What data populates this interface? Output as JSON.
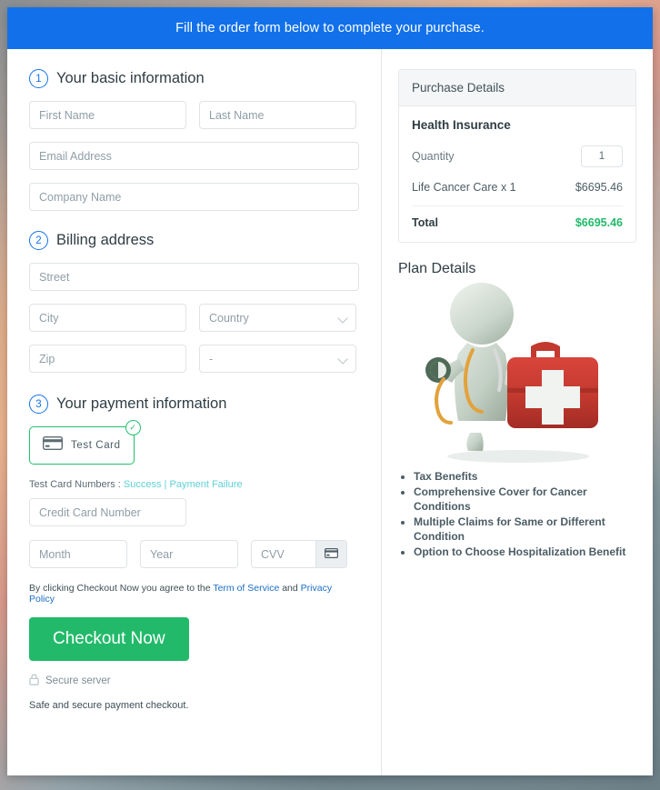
{
  "banner": {
    "text": "Fill the order form below to complete your purchase."
  },
  "sections": {
    "basic": {
      "number": "1",
      "title": "Your basic information",
      "fields": {
        "first_name": "First Name",
        "last_name": "Last Name",
        "email": "Email Address",
        "company": "Company Name"
      }
    },
    "billing": {
      "number": "2",
      "title": "Billing address",
      "fields": {
        "street": "Street",
        "city": "City",
        "country": "Country",
        "zip": "Zip",
        "state": "-"
      }
    },
    "payment": {
      "number": "3",
      "title": "Your payment information",
      "card_option_label": "Test  Card",
      "card_option_icon": "credit-card-icon",
      "selected_badge": "✓",
      "test_numbers_prefix": "Test Card Numbers : ",
      "test_success_link": "Success",
      "test_separator": " | ",
      "test_failure_link": "Payment Failure",
      "fields": {
        "credit_card": "Credit Card Number",
        "month": "Month",
        "year": "Year",
        "cvv": "CVV"
      },
      "terms_prefix": "By clicking Checkout Now you agree to the ",
      "terms_link": "Term of Service",
      "terms_and": " and ",
      "privacy_link": "Privacy Policy",
      "checkout_label": "Checkout Now",
      "secure_server": "Secure server",
      "safe_note": "Safe and secure payment checkout."
    }
  },
  "purchase": {
    "header": "Purchase Details",
    "product": "Health Insurance",
    "quantity_label": "Quantity",
    "quantity_value": "1",
    "line_item": "Life Cancer Care x 1",
    "line_amount": "$6695.46",
    "total_label": "Total",
    "total_amount": "$6695.46"
  },
  "plan": {
    "title": "Plan Details",
    "illustration": "doctor-with-first-aid-kit-illustration",
    "benefits": [
      "Tax Benefits",
      "Comprehensive Cover for Cancer Conditions",
      "Multiple Claims for Same or Different Condition",
      "Option to Choose Hospitalization Benefit"
    ]
  },
  "colors": {
    "banner_blue": "#1271ea",
    "accent_green": "#22ba6a",
    "link_blue": "#1b6fc4",
    "link_teal": "#5ed0d6"
  }
}
